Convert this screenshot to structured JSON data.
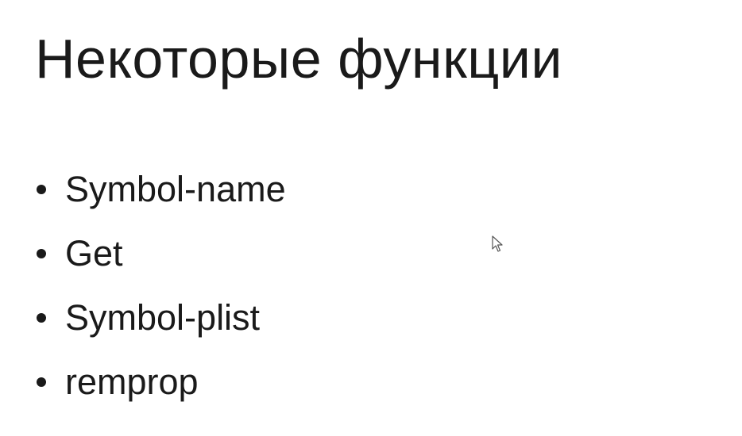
{
  "slide": {
    "title": "Некоторые функции",
    "bullets": [
      {
        "label": "Symbol-name"
      },
      {
        "label": "Get"
      },
      {
        "label": "Symbol-plist"
      },
      {
        "label": "remprop"
      }
    ]
  },
  "cursor": {
    "icon": "mouse-pointer-icon"
  }
}
